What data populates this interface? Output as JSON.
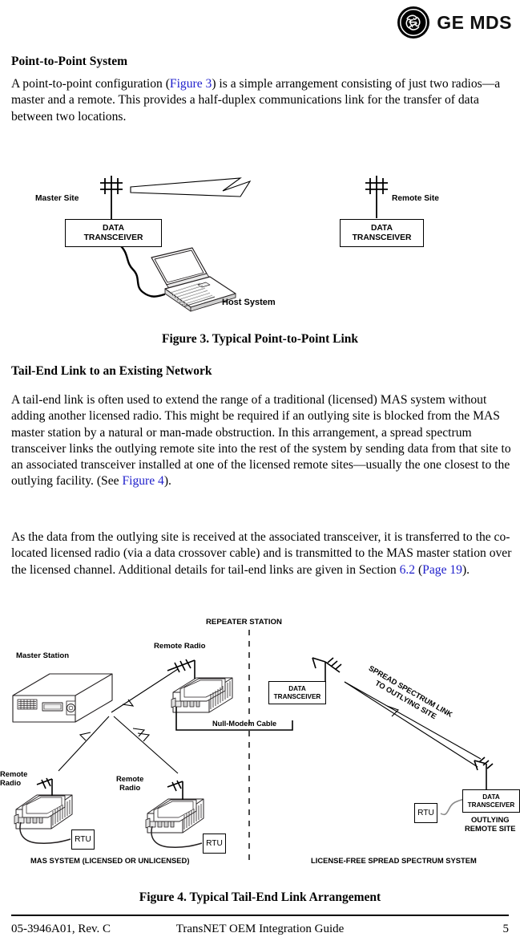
{
  "header": {
    "logo_icon": "ge-roundel-icon",
    "brand": "GE MDS"
  },
  "sections": [
    {
      "heading": "Point-to-Point System",
      "paragraphs": [
        "A point-to-point configuration (Figure 3) is a simple arrangement consisting of just two radios—a master and a remote. This provides a half-duplex communications link for the transfer of data between two locations."
      ]
    },
    {
      "heading": "Tail-End Link to an Existing Network",
      "paragraphs": [
        "A tail-end link is often used to extend the range of a traditional (licensed) MAS system without adding another licensed radio. This might be required if an outlying site is blocked from the MAS master station by a natural or man-made obstruction. In this arrangement, a spread spectrum transceiver links the outlying remote site into the rest of the system by sending data from that site to an associated transceiver installed at one of the licensed remote sites—usually the one closest to the outlying facility. (See Figure 4).",
        "As the data from the outlying site is received at the associated transceiver, it is transferred to the co-located licensed radio (via a data crossover cable) and is transmitted to the MAS master station over the licensed channel. Additional details for tail-end links are given in Section 6.2 (Page 19)."
      ]
    }
  ],
  "para1": {
    "t1": "A point-to-point configuration (",
    "x1": "Figure 3",
    "t2": ") is a simple arrangement consisting of just two radios—a master and a remote. This provides a half-duplex communications link for the transfer of data between two locations."
  },
  "para2": {
    "t1": "A tail-end link is often used to extend the range of a traditional (licensed) MAS system without adding another licensed radio. This might be required if an outlying site is blocked from the MAS master station by a natural or man-made obstruction. In this arrangement, a spread spectrum transceiver links the outlying remote site into the rest of the system by sending data from that site to an associated transceiver installed at one of the licensed remote sites—usually the one closest to the outlying facility. (See ",
    "x1": "Figure 4",
    "t2": ")."
  },
  "para3": {
    "t1": "As the data from the outlying site is received at the associated transceiver, it is transferred to the co-located licensed radio (via a data crossover cable) and is transmitted to the MAS master station over the licensed channel. Additional details for tail-end links are given in Section ",
    "x1": "6.2",
    "t2": " (",
    "x2": "Page 19",
    "t3": ")."
  },
  "figure3": {
    "caption": "Figure 3. Typical Point-to-Point Link",
    "labels": {
      "master_site": "Master Site",
      "remote_site": "Remote Site",
      "host_system": "Host System",
      "transceiver_left_line1": "DATA",
      "transceiver_left_line2": "TRANSCEIVER",
      "transceiver_right_line1": "DATA",
      "transceiver_right_line2": "TRANSCEIVER"
    },
    "icons": {
      "antenna_left": "antenna-icon",
      "antenna_right": "antenna-icon",
      "rf_link": "rf-link-icon",
      "laptop": "laptop-icon",
      "cable": "cable-icon"
    }
  },
  "figure4": {
    "caption": "Figure 4. Typical Tail-End Link Arrangement",
    "labels": {
      "repeater_station": "REPEATER STATION",
      "master_station": "Master Station",
      "remote_radio_top": "Remote Radio",
      "null_modem_cable": "Null-Modem Cable",
      "data_transceiver_repeater_l1": "DATA",
      "data_transceiver_repeater_l2": "TRANSCEIVER",
      "spread_spectrum_link_l1": "SPREAD SPECTRUM LINK",
      "spread_spectrum_link_l2": "TO OUTLYING SITE",
      "remote_radio_left_l1": "Remote",
      "remote_radio_left_l2": "Radio",
      "remote_radio_mid_l1": "Remote",
      "remote_radio_mid_l2": "Radio",
      "rtu_left": "RTU",
      "rtu_mid": "RTU",
      "rtu_right": "RTU",
      "data_transceiver_outlying_l1": "DATA",
      "data_transceiver_outlying_l2": "TRANSCEIVER",
      "outlying_remote_site_l1": "OUTLYING",
      "outlying_remote_site_l2": "REMOTE SITE",
      "mas_system": "MAS SYSTEM (LICENSED OR UNLICENSED)",
      "spread_spectrum_system": "LICENSE-FREE SPREAD SPECTRUM SYSTEM"
    },
    "icons": {
      "master_station_chassis": "rack-chassis-icon",
      "remote_radio_unit": "radio-modem-icon",
      "antenna": "antenna-icon",
      "divider": "dashed-divider-icon"
    }
  },
  "footer": {
    "doc_number": "05-3946A01, Rev. C",
    "title": "TransNET OEM Integration Guide",
    "page": "5"
  },
  "colors": {
    "link": "#2020cc",
    "text": "#000000",
    "background": "#ffffff"
  }
}
